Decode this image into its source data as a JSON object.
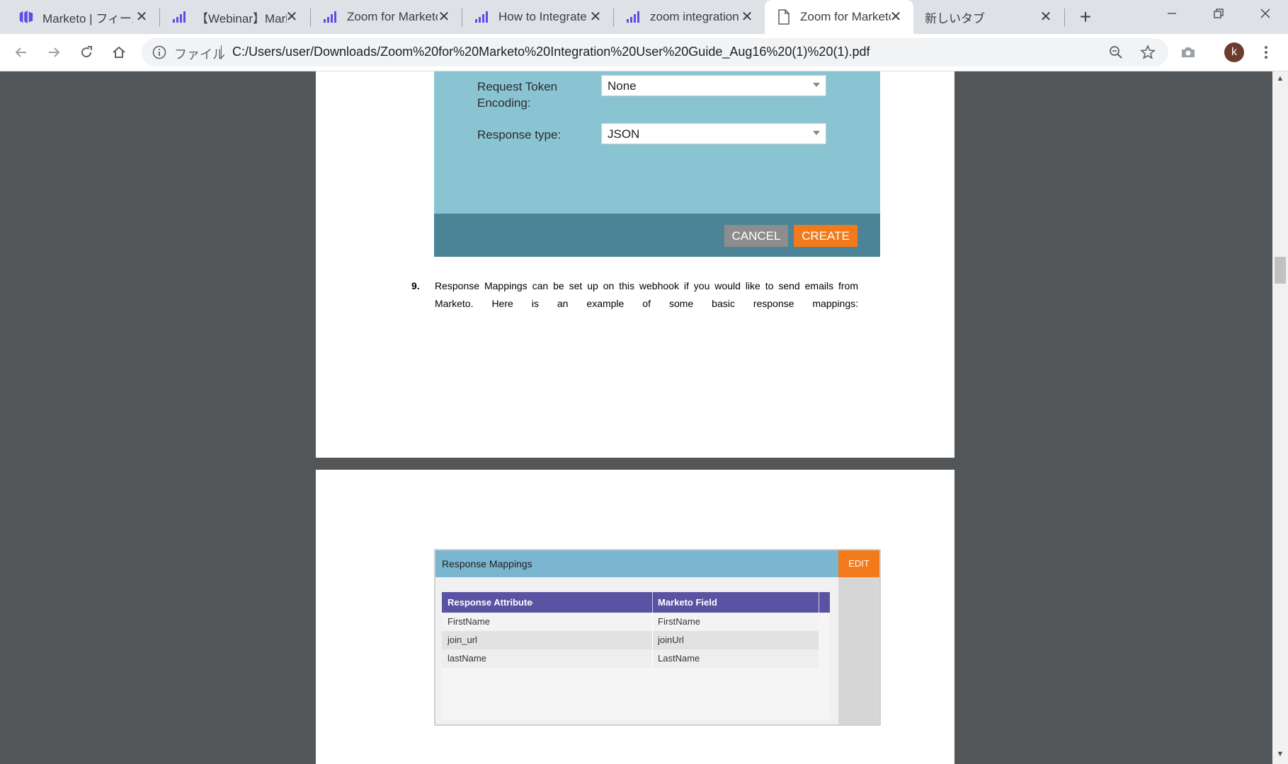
{
  "tabs": [
    {
      "title": "Marketo | フィールド",
      "active": false,
      "icon": "marketo-icon"
    },
    {
      "title": "【Webinar】Marketo",
      "active": false,
      "icon": "bars-icon"
    },
    {
      "title": "Zoom for Marketo",
      "active": false,
      "icon": "bars-icon"
    },
    {
      "title": "How to Integrate",
      "active": false,
      "icon": "bars-icon"
    },
    {
      "title": "zoom integration",
      "active": false,
      "icon": "bars-icon"
    },
    {
      "title": "Zoom for Marketo",
      "active": true,
      "icon": "document-icon"
    },
    {
      "title": "新しいタブ",
      "active": false,
      "icon": ""
    }
  ],
  "omnibox": {
    "label": "ファイル",
    "url": "C:/Users/user/Downloads/Zoom%20for%20Marketo%20Integration%20User%20Guide_Aug16%20(1)%20(1).pdf"
  },
  "profile": {
    "initial": "k"
  },
  "form": {
    "encoding_label_1": "Request Token",
    "encoding_label_2": "Encoding:",
    "encoding_value": "None",
    "response_label": "Response type:",
    "response_value": "JSON",
    "cancel": "CANCEL",
    "create": "CREATE"
  },
  "step": {
    "number": "9.",
    "line1": "Response Mappings can be set up on this webhook if you would like to send emails from",
    "line2": "Marketo. Here is an example of some basic response mappings:"
  },
  "mappings": {
    "title": "Response Mappings",
    "edit": "EDIT",
    "col1": "Response Attribute",
    "col2": "Marketo Field",
    "rows": [
      {
        "attr": "FirstName",
        "field": "FirstName"
      },
      {
        "attr": "join_url",
        "field": "joinUrl"
      },
      {
        "attr": "lastName",
        "field": "LastName"
      }
    ]
  },
  "colors": {
    "marketo_purple": "#5a52a2",
    "orange": "#f27a1b",
    "teal": "#8ac4d2"
  }
}
